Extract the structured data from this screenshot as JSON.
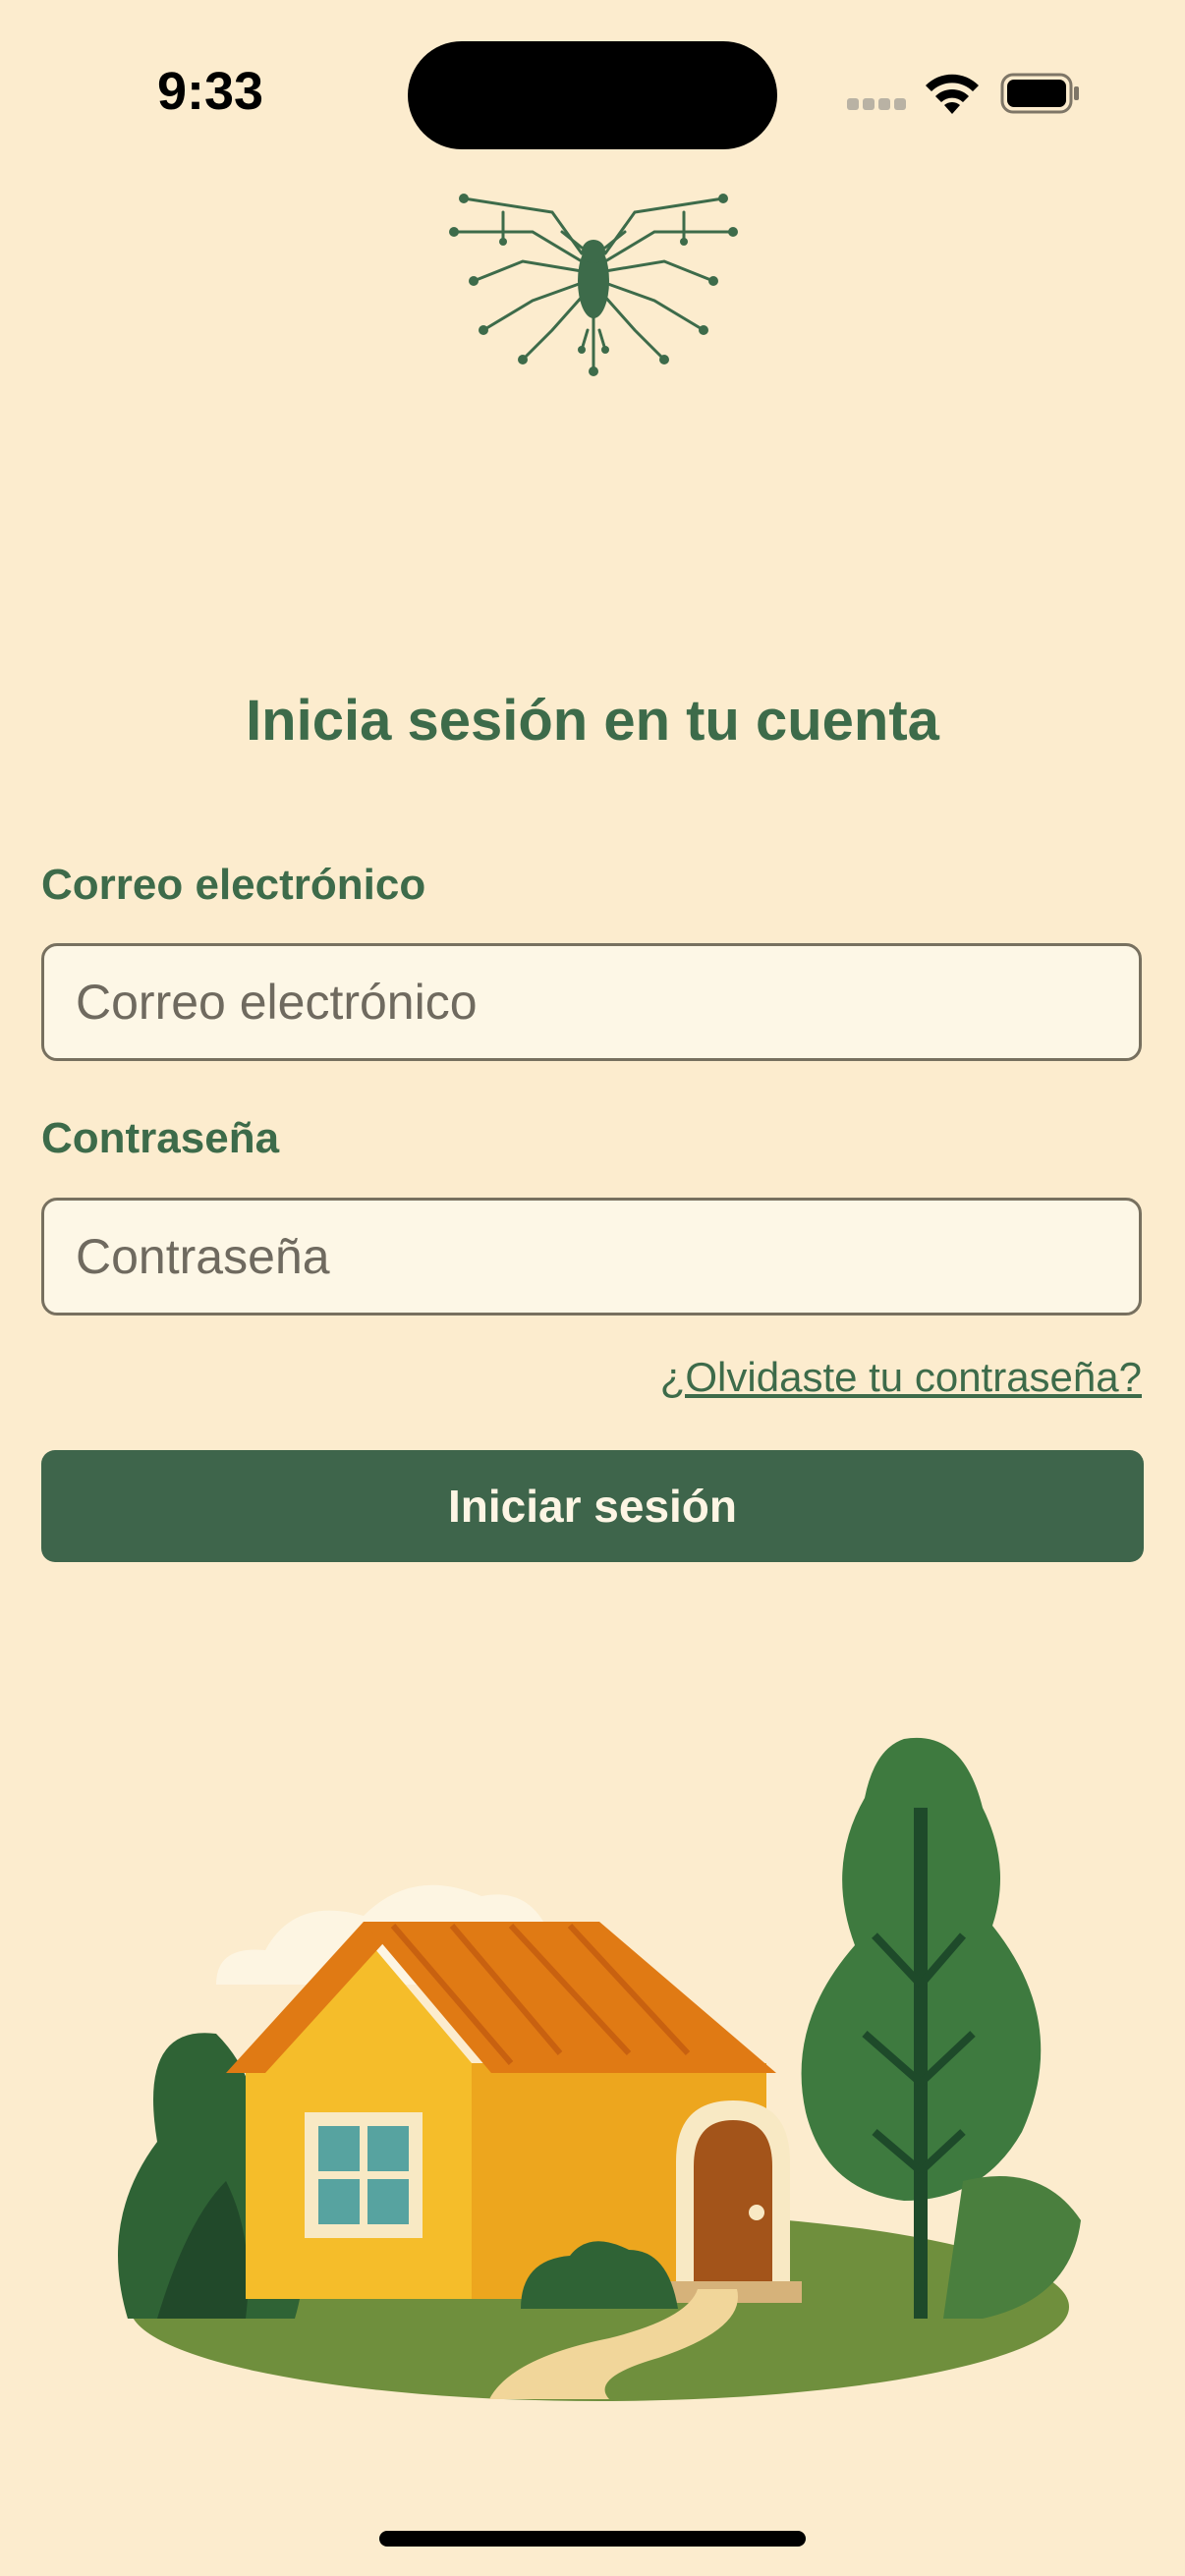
{
  "status_bar": {
    "time": "9:33",
    "icons": [
      "cellular-signal-icon",
      "wifi-icon",
      "battery-icon"
    ]
  },
  "branding": {
    "logo_icon": "circuit-moth-logo"
  },
  "login": {
    "title": "Inicia sesión en tu cuenta",
    "email_label": "Correo electrónico",
    "email_placeholder": "Correo electrónico",
    "email_value": "",
    "password_label": "Contraseña",
    "password_placeholder": "Contraseña",
    "password_value": "",
    "forgot_link": "¿Olvidaste tu contraseña?",
    "submit_label": "Iniciar sesión"
  },
  "illustration": {
    "icon": "house-with-trees-illustration"
  },
  "colors": {
    "background": "#fcecce",
    "accent": "#3e654b",
    "input_background": "#fdf7e6"
  }
}
